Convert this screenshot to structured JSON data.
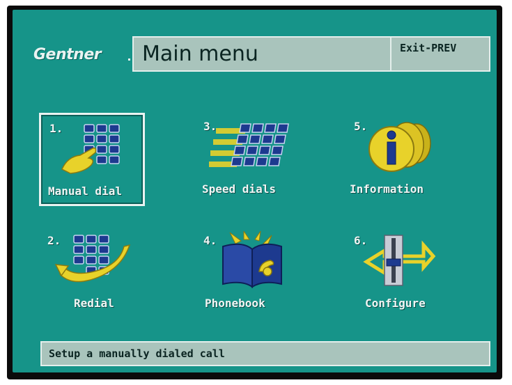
{
  "brand": "Gentner",
  "header": {
    "title": "Main menu",
    "exit_label": "Exit-PREV"
  },
  "menu": {
    "items": [
      {
        "number": "1.",
        "label": "Manual dial",
        "icon": "keypad-hand-icon",
        "selected": true
      },
      {
        "number": "2.",
        "label": "Redial",
        "icon": "redial-keypad-arrow-icon",
        "selected": false
      },
      {
        "number": "3.",
        "label": "Speed dials",
        "icon": "speed-dial-keypad-icon",
        "selected": false
      },
      {
        "number": "4.",
        "label": "Phonebook",
        "icon": "phonebook-icon",
        "selected": false
      },
      {
        "number": "5.",
        "label": "Information",
        "icon": "information-icon",
        "selected": false
      },
      {
        "number": "6.",
        "label": "Configure",
        "icon": "configure-slider-icon",
        "selected": false
      }
    ]
  },
  "status": {
    "text": "Setup a manually dialed call"
  },
  "colors": {
    "background": "#169489",
    "panel": "#a9c4bc",
    "text_light": "#f0f5f4",
    "text_dark": "#0a2421",
    "icon_yellow": "#e8d22a",
    "icon_blue": "#1d3a8f"
  }
}
